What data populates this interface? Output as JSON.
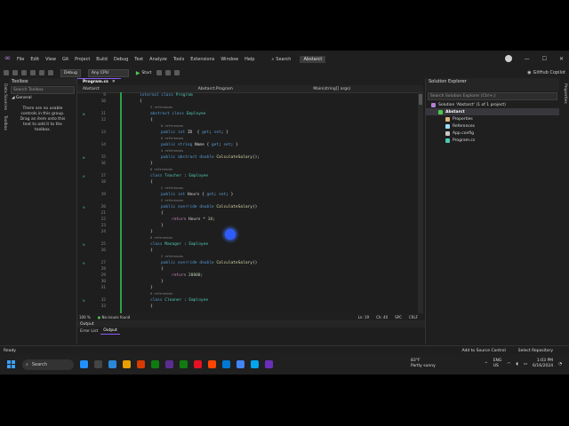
{
  "menubar": {
    "items": [
      "File",
      "Edit",
      "View",
      "Git",
      "Project",
      "Build",
      "Debug",
      "Test",
      "Analyze",
      "Tools",
      "Extensions",
      "Window",
      "Help"
    ],
    "search_label": "Search",
    "solution_badge": "Abstarct",
    "copilot": "GitHub Copilot"
  },
  "toolbar": {
    "config": "Debug",
    "platform": "Any CPU",
    "start": "Start"
  },
  "left_tabs": [
    "Data Sources",
    "Toolbox"
  ],
  "toolbox": {
    "title": "Toolbox",
    "search_placeholder": "Search Toolbox",
    "group": "General",
    "message": "There are no usable controls in this group. Drag an item onto this text to add it to the toolbox."
  },
  "editor": {
    "tab": "Program.cs",
    "nav": [
      "Abstarct",
      "Abstarct.Program",
      "Main(string[] args)"
    ],
    "lines": [
      {
        "n": "9",
        "indent": 0,
        "parts": [
          [
            "kw",
            "internal "
          ],
          [
            "kw",
            "class "
          ],
          [
            "ty",
            "Program"
          ]
        ]
      },
      {
        "n": "10",
        "indent": 0,
        "parts": [
          [
            "pl",
            "{"
          ]
        ]
      },
      {
        "n": "",
        "indent": 1,
        "ref": "3 references"
      },
      {
        "n": "11",
        "indent": 1,
        "glyph": "I",
        "parts": [
          [
            "kw",
            "abstract "
          ],
          [
            "kw",
            "class "
          ],
          [
            "ty",
            "Employee"
          ]
        ]
      },
      {
        "n": "12",
        "indent": 1,
        "parts": [
          [
            "pl",
            "{"
          ]
        ]
      },
      {
        "n": "",
        "indent": 2,
        "ref": "0 references"
      },
      {
        "n": "13",
        "indent": 2,
        "parts": [
          [
            "kw",
            "public "
          ],
          [
            "kw",
            "int "
          ],
          [
            "pl",
            "ID  { "
          ],
          [
            "kw",
            "get"
          ],
          [
            "pl",
            "; "
          ],
          [
            "kw",
            "set"
          ],
          [
            "pl",
            "; }"
          ]
        ]
      },
      {
        "n": "",
        "indent": 2,
        "ref": "0 references"
      },
      {
        "n": "14",
        "indent": 2,
        "parts": [
          [
            "kw",
            "public "
          ],
          [
            "kw",
            "string "
          ],
          [
            "pl",
            "Name { "
          ],
          [
            "kw",
            "get"
          ],
          [
            "pl",
            "; "
          ],
          [
            "kw",
            "set"
          ],
          [
            "pl",
            "; }"
          ]
        ]
      },
      {
        "n": "",
        "indent": 2,
        "ref": "4 references"
      },
      {
        "n": "15",
        "indent": 2,
        "glyph": "I",
        "parts": [
          [
            "kw",
            "public "
          ],
          [
            "kw",
            "abstract "
          ],
          [
            "kw",
            "double "
          ],
          [
            "fn",
            "CalculateSalary"
          ],
          [
            "pl",
            "();"
          ]
        ]
      },
      {
        "n": "16",
        "indent": 1,
        "parts": [
          [
            "pl",
            "}"
          ]
        ]
      },
      {
        "n": "",
        "indent": 1,
        "ref": "0 references"
      },
      {
        "n": "17",
        "indent": 1,
        "glyph": "O",
        "parts": [
          [
            "kw",
            "class "
          ],
          [
            "ty",
            "Teacher"
          ],
          [
            "pl",
            " : "
          ],
          [
            "ty",
            "Employee"
          ]
        ]
      },
      {
        "n": "18",
        "indent": 1,
        "parts": [
          [
            "pl",
            "{"
          ]
        ]
      },
      {
        "n": "",
        "indent": 2,
        "ref": "2 references"
      },
      {
        "n": "19",
        "indent": 2,
        "parts": [
          [
            "kw",
            "public "
          ],
          [
            "kw",
            "int "
          ],
          [
            "pl",
            "Hours { "
          ],
          [
            "kw",
            "get"
          ],
          [
            "pl",
            "; "
          ],
          [
            "kw",
            "set"
          ],
          [
            "pl",
            "; }"
          ]
        ]
      },
      {
        "n": "",
        "indent": 2,
        "ref": "2 references"
      },
      {
        "n": "20",
        "indent": 2,
        "glyph": "O",
        "parts": [
          [
            "kw",
            "public "
          ],
          [
            "kw",
            "override "
          ],
          [
            "kw",
            "double "
          ],
          [
            "fn",
            "CalculateSalary"
          ],
          [
            "pl",
            "()"
          ]
        ]
      },
      {
        "n": "21",
        "indent": 2,
        "parts": [
          [
            "pl",
            "{"
          ]
        ]
      },
      {
        "n": "22",
        "indent": 3,
        "parts": [
          [
            "cl",
            "return "
          ],
          [
            "pl",
            "Hours * "
          ],
          [
            "num",
            "10"
          ],
          [
            "pl",
            ";"
          ]
        ]
      },
      {
        "n": "23",
        "indent": 2,
        "parts": [
          [
            "pl",
            "}"
          ]
        ]
      },
      {
        "n": "24",
        "indent": 1,
        "parts": [
          [
            "pl",
            "}"
          ]
        ]
      },
      {
        "n": "",
        "indent": 1,
        "ref": "0 references"
      },
      {
        "n": "25",
        "indent": 1,
        "glyph": "O",
        "parts": [
          [
            "kw",
            "class "
          ],
          [
            "ty",
            "Manager"
          ],
          [
            "pl",
            " : "
          ],
          [
            "ty",
            "Employee"
          ]
        ]
      },
      {
        "n": "26",
        "indent": 1,
        "parts": [
          [
            "pl",
            "{"
          ]
        ]
      },
      {
        "n": "",
        "indent": 2,
        "ref": "2 references"
      },
      {
        "n": "27",
        "indent": 2,
        "glyph": "O",
        "parts": [
          [
            "kw",
            "public "
          ],
          [
            "kw",
            "override "
          ],
          [
            "kw",
            "double "
          ],
          [
            "fn",
            "CalculateSalary"
          ],
          [
            "pl",
            "()"
          ]
        ]
      },
      {
        "n": "28",
        "indent": 2,
        "parts": [
          [
            "pl",
            "{"
          ]
        ]
      },
      {
        "n": "29",
        "indent": 3,
        "parts": [
          [
            "cl",
            "return "
          ],
          [
            "num",
            "20000"
          ],
          [
            "pl",
            ";"
          ]
        ]
      },
      {
        "n": "30",
        "indent": 2,
        "parts": [
          [
            "pl",
            "}"
          ]
        ]
      },
      {
        "n": "31",
        "indent": 1,
        "parts": [
          [
            "pl",
            "}"
          ]
        ]
      },
      {
        "n": "",
        "indent": 1,
        "ref": "0 references"
      },
      {
        "n": "32",
        "indent": 1,
        "glyph": "O",
        "parts": [
          [
            "kw",
            "class "
          ],
          [
            "ty",
            "Cleaner"
          ],
          [
            "pl",
            " : "
          ],
          [
            "ty",
            "Employee"
          ]
        ]
      },
      {
        "n": "33",
        "indent": 1,
        "parts": [
          [
            "pl",
            "{"
          ]
        ]
      }
    ],
    "status": {
      "zoom": "100 %",
      "issues": "No issues found",
      "ln": "Ln: 19",
      "ch": "Ch: 40",
      "spc": "SPC",
      "eol": "CRLF"
    },
    "output_title": "Output",
    "output_tabs": [
      "Error List",
      "Output"
    ]
  },
  "solution_explorer": {
    "title": "Solution Explorer",
    "search_placeholder": "Search Solution Explorer (Ctrl+;)",
    "items": [
      {
        "label": "Solution 'Abstarct' (1 of 1 project)",
        "level": 0,
        "icon": "#b180d7"
      },
      {
        "label": "Abstarct",
        "level": 1,
        "icon": "#4ec94e",
        "selected": true
      },
      {
        "label": "Properties",
        "level": 2,
        "icon": "#dcb67a"
      },
      {
        "label": "References",
        "level": 2,
        "icon": "#9cdcfe"
      },
      {
        "label": "App.config",
        "level": 2,
        "icon": "#c8c8c8"
      },
      {
        "label": "Program.cs",
        "level": 2,
        "icon": "#4ec9b0"
      }
    ]
  },
  "right_tabs": [
    "Properties"
  ],
  "vs_status": {
    "ready": "Ready",
    "add_source": "Add to Source Control",
    "select_repo": "Select Repository"
  },
  "taskbar": {
    "search": "Search",
    "weather_temp": "83°F",
    "weather_desc": "Partly sunny",
    "lang": "ENG",
    "region": "US",
    "time": "1:03 PM",
    "date": "6/16/2024",
    "apps": [
      "#1e90ff",
      "#444",
      "#2b88d8",
      "#e8a000",
      "#d83b01",
      "#0f7b0f",
      "#5c2d91",
      "#107c10",
      "#e81123",
      "#ff4500",
      "#0078d4",
      "#4285f4",
      "#00a4ef",
      "#6b2fbb"
    ]
  },
  "colors": {
    "accent": "#8b5cf6",
    "gutter_change": "#2ea043"
  }
}
